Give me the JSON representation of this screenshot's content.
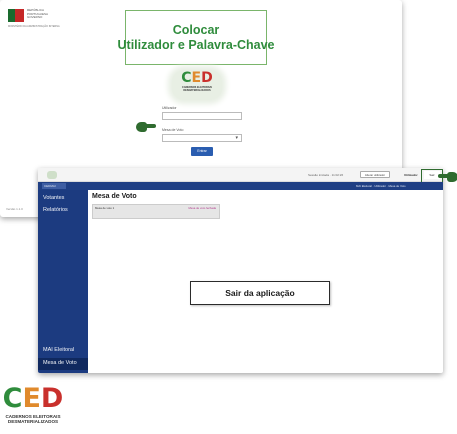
{
  "login": {
    "gov_lines": [
      "REPÚBLICA",
      "PORTUGUESA",
      "GOVERNO"
    ],
    "gov_ministry": "MINISTÉRIO DA ADMINISTRAÇÃO INTERNA",
    "title_line1": "Colocar",
    "title_line2": "Utilizador e Palavra-Chave",
    "user_label": "Utilizador",
    "pass_label": "Mesa de Voto",
    "login_button": "Entrar",
    "footer": "Versão 1.1.0"
  },
  "brand_logo": {
    "letters": [
      "C",
      "E",
      "D"
    ],
    "letter_colors": [
      "#2f8c3c",
      "#e08a2c",
      "#c9302c"
    ],
    "sub_line1": "CADERNOS ELEITORAIS",
    "sub_line2": "DESMATERIALIZADOS"
  },
  "app": {
    "session_text": "Sessão iniciada · 11:02:26",
    "change_user_button": "Alterar utilizador",
    "username": "Utilizador",
    "exit_button": "Sair",
    "navbar_brand": "CEDMAI",
    "navbar_right": "MAI Eleitoral · Utilizador · Mesa de Voto",
    "sidebar": {
      "votantes": "Votantes",
      "relatorios": "Relatórios",
      "mai_eleitoral": "MAI Eleitoral",
      "mesa_de_voto": "Mesa de Voto"
    },
    "main_title": "Mesa de Voto",
    "card_left": "Mesa de voto 1",
    "card_right": "Mesa de voto fechada"
  },
  "callout": "Sair da aplicação",
  "colors": {
    "sidebar": "#1c3b80",
    "accent_green": "#2f8c3c",
    "callout_border": "#2b2b2b"
  }
}
